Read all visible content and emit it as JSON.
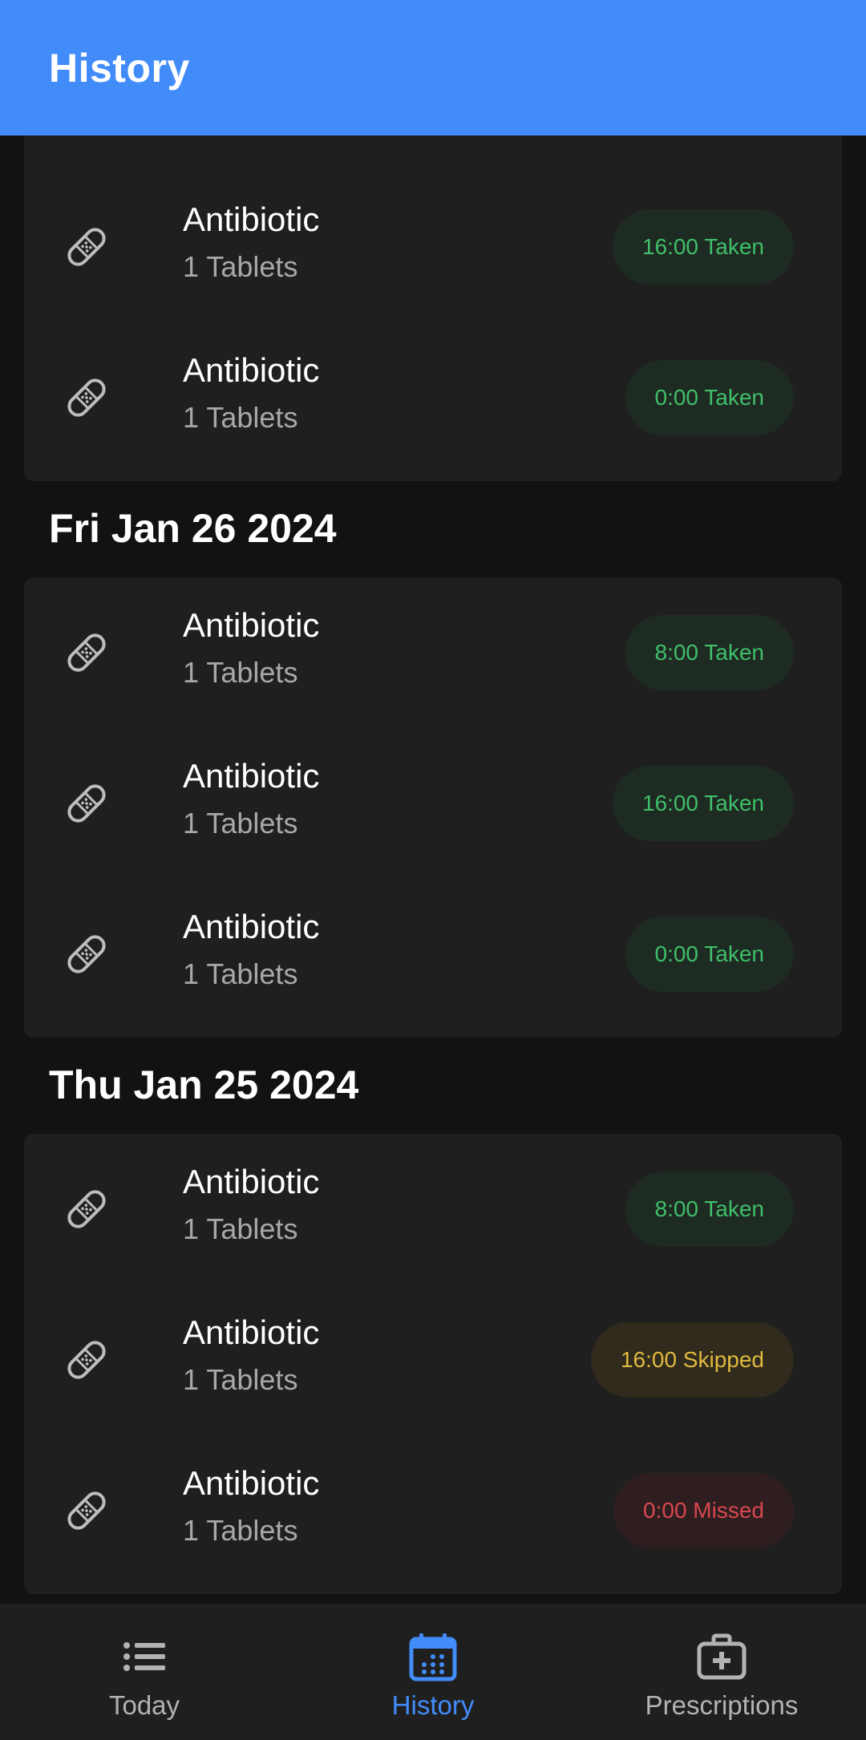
{
  "app_bar": {
    "title": "History"
  },
  "top_partial_card": {
    "rows": [
      {
        "name": "Antibiotic",
        "dose": "1 Tablets",
        "badge": "",
        "status": "taken"
      },
      {
        "name": "Antibiotic",
        "dose": "1 Tablets",
        "badge": "16:00 Taken",
        "status": "taken"
      },
      {
        "name": "Antibiotic",
        "dose": "1 Tablets",
        "badge": "0:00 Taken",
        "status": "taken"
      }
    ]
  },
  "days": [
    {
      "date": "Fri Jan 26 2024",
      "rows": [
        {
          "name": "Antibiotic",
          "dose": "1 Tablets",
          "badge": "8:00 Taken",
          "status": "taken"
        },
        {
          "name": "Antibiotic",
          "dose": "1 Tablets",
          "badge": "16:00 Taken",
          "status": "taken"
        },
        {
          "name": "Antibiotic",
          "dose": "1 Tablets",
          "badge": "0:00 Taken",
          "status": "taken"
        }
      ]
    },
    {
      "date": "Thu Jan 25 2024",
      "rows": [
        {
          "name": "Antibiotic",
          "dose": "1 Tablets",
          "badge": "8:00 Taken",
          "status": "taken"
        },
        {
          "name": "Antibiotic",
          "dose": "1 Tablets",
          "badge": "16:00 Skipped",
          "status": "skipped"
        },
        {
          "name": "Antibiotic",
          "dose": "1 Tablets",
          "badge": "0:00 Missed",
          "status": "missed"
        }
      ]
    }
  ],
  "nav": {
    "items": [
      {
        "label": "Today",
        "icon": "list-icon",
        "active": false
      },
      {
        "label": "History",
        "icon": "calendar-icon",
        "active": true
      },
      {
        "label": "Prescriptions",
        "icon": "medical-kit-icon",
        "active": false
      }
    ]
  },
  "colors": {
    "accent": "#428cfa",
    "taken": "#3fbf6a",
    "skipped": "#e0b93e",
    "missed": "#d9474f"
  }
}
